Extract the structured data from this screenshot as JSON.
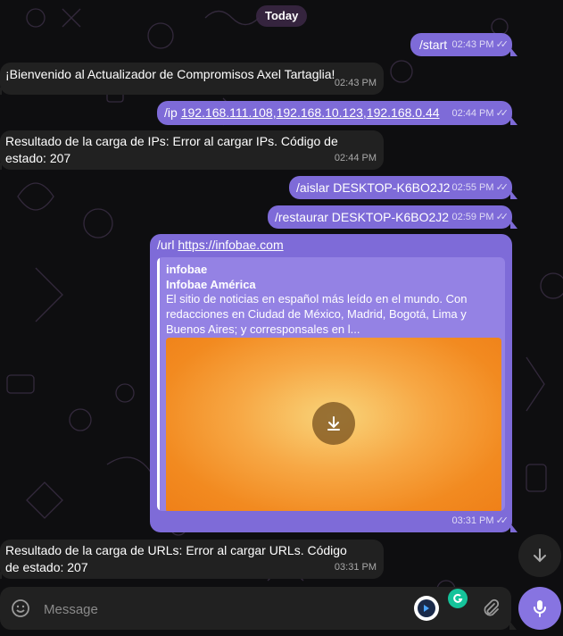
{
  "date_separator": "Today",
  "messages": [
    {
      "text": "/start",
      "time": "02:43 PM",
      "outgoing": true
    },
    {
      "text": "¡Bienvenido al Actualizador de Compromisos Axel Tartaglia!",
      "time": "02:43 PM",
      "outgoing": false
    },
    {
      "prefix": "/ip ",
      "link": "192.168.111.108,192.168.10.123,192.168.0.44",
      "time": "02:44 PM",
      "outgoing": true
    },
    {
      "text": "Resultado de la carga de IPs: Error al cargar IPs. Código de estado: 207",
      "time": "02:44 PM",
      "outgoing": false
    },
    {
      "text": "/aislar DESKTOP-K6BO2J2",
      "time": "02:55 PM",
      "outgoing": true
    },
    {
      "text": "/restaurar DESKTOP-K6BO2J2",
      "time": "02:59 PM",
      "outgoing": true
    },
    {
      "prefix": "/url ",
      "link": "https://infobae.com",
      "time": "03:31 PM",
      "outgoing": true,
      "preview": {
        "site": "infobae",
        "title": "Infobae América",
        "description": "El sitio de noticias en español más leído en el mundo. Con redacciones en Ciudad de México, Madrid, Bogotá, Lima y Buenos Aires; y corresponsales en l..."
      }
    },
    {
      "text": "Resultado de la carga de URLs: Error al cargar URLs. Código de estado: 207",
      "time": "03:31 PM",
      "outgoing": false
    }
  ],
  "composer": {
    "placeholder": "Message"
  },
  "colors": {
    "outgoing": "#7e6bd8",
    "incoming": "#212121",
    "accent": "#8774e1",
    "preview_image": "#f28a20"
  },
  "icons": {
    "emoji": "smile-icon",
    "bot_app": "bot-app-icon",
    "grammarly": "grammarly-icon",
    "attach": "paperclip-icon",
    "mic": "microphone-icon",
    "scroll": "arrow-down-icon",
    "download": "download-icon",
    "read": "double-check-icon"
  }
}
